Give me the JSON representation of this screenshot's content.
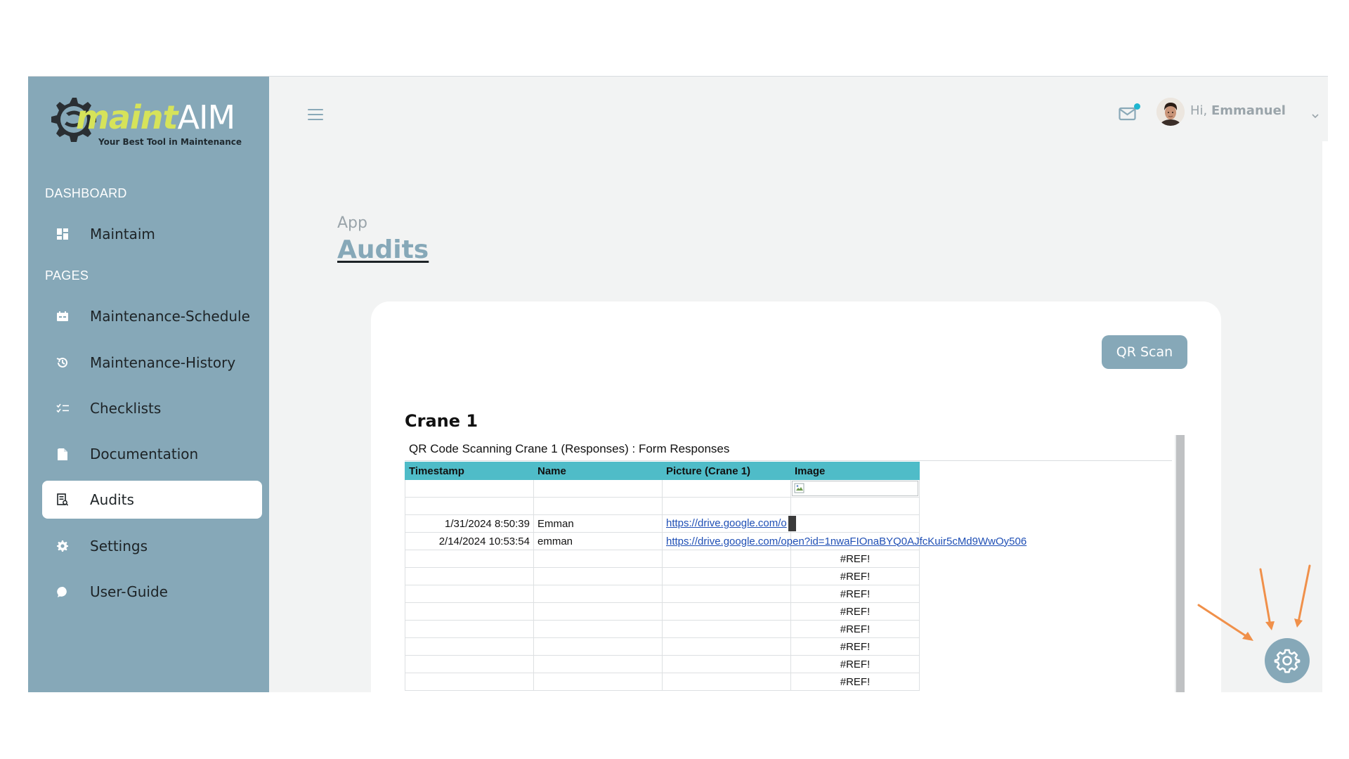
{
  "sidebar": {
    "logo": {
      "word_maint": "maint",
      "word_aim": "AIM",
      "tagline": "Your Best Tool in Maintenance"
    },
    "sections": [
      {
        "title": "DASHBOARD",
        "items": [
          {
            "label": "Maintaim",
            "icon": "dashboard-icon"
          }
        ]
      },
      {
        "title": "PAGES",
        "items": [
          {
            "label": "Maintenance-Schedule",
            "icon": "calendar-icon"
          },
          {
            "label": "Maintenance-History",
            "icon": "history-icon"
          },
          {
            "label": "Checklists",
            "icon": "checklist-icon"
          },
          {
            "label": "Documentation",
            "icon": "document-icon"
          },
          {
            "label": "Audits",
            "icon": "audit-icon",
            "active": true
          },
          {
            "label": "Settings",
            "icon": "gear-icon"
          },
          {
            "label": "User-Guide",
            "icon": "chat-icon"
          }
        ]
      }
    ]
  },
  "header": {
    "greeting_prefix": "Hi, ",
    "user_name": "Emmanuel",
    "mail_has_unread": true
  },
  "page": {
    "breadcrumb": "App",
    "title": "Audits"
  },
  "card": {
    "qr_button": "QR Scan",
    "section_title": "Crane 1",
    "sheet": {
      "title": "QR Code Scanning Crane 1 (Responses) : Form Responses",
      "columns": [
        "Timestamp",
        "Name",
        "Picture (Crane 1)",
        "Image"
      ],
      "rows": [
        {
          "timestamp": "",
          "name": "",
          "picture": "",
          "image": ""
        },
        {
          "timestamp": "",
          "name": "",
          "picture": "",
          "image": ""
        },
        {
          "timestamp": "1/31/2024 8:50:39",
          "name": "Emman",
          "picture": "https://drive.google.com/o",
          "image": ""
        },
        {
          "timestamp": "2/14/2024 10:53:54",
          "name": "emman",
          "picture": "https://drive.google.com/open?id=1nwaFIOnaBYQ0AJfcKuir5cMd9WwOy506",
          "image": ""
        },
        {
          "timestamp": "",
          "name": "",
          "picture": "",
          "image": "#REF!"
        },
        {
          "timestamp": "",
          "name": "",
          "picture": "",
          "image": "#REF!"
        },
        {
          "timestamp": "",
          "name": "",
          "picture": "",
          "image": "#REF!"
        },
        {
          "timestamp": "",
          "name": "",
          "picture": "",
          "image": "#REF!"
        },
        {
          "timestamp": "",
          "name": "",
          "picture": "",
          "image": "#REF!"
        },
        {
          "timestamp": "",
          "name": "",
          "picture": "",
          "image": "#REF!"
        },
        {
          "timestamp": "",
          "name": "",
          "picture": "",
          "image": "#REF!"
        },
        {
          "timestamp": "",
          "name": "",
          "picture": "",
          "image": "#REF!"
        }
      ]
    }
  },
  "colors": {
    "sidebar": "#86a8b8",
    "header_row": "#4fbcc8",
    "accent_dot": "#1fb6d0",
    "arrow": "#f0904a",
    "logo_green": "#d6e35a"
  }
}
